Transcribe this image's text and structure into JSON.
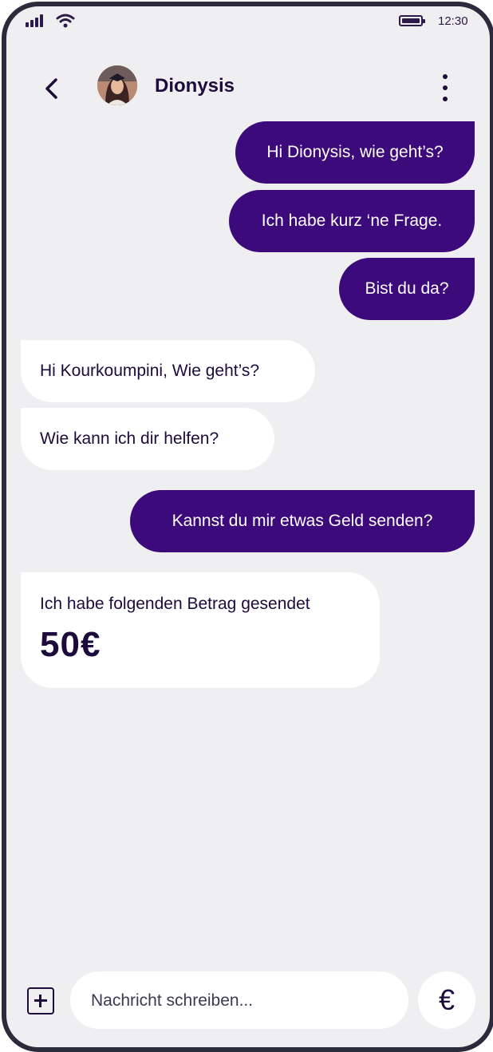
{
  "status_bar": {
    "time": "12:30",
    "icons": [
      "signal-icon",
      "wifi-icon",
      "battery-icon"
    ]
  },
  "header": {
    "back_icon": "chevron-left-icon",
    "contact_name": "Dionysis",
    "more_icon": "more-vertical-icon"
  },
  "messages": [
    {
      "direction": "outgoing",
      "text": "Hi Dionysis, wie geht’s?"
    },
    {
      "direction": "outgoing",
      "text": "Ich habe kurz ‘ne Frage."
    },
    {
      "direction": "outgoing",
      "text": "Bist du da?"
    },
    {
      "direction": "incoming",
      "text": "Hi Kourkoumpini, Wie geht’s?"
    },
    {
      "direction": "incoming",
      "text": "Wie kann ich dir helfen?"
    },
    {
      "direction": "outgoing",
      "text": "Kannst du mir etwas Geld senden?"
    },
    {
      "direction": "incoming",
      "text": "Ich habe folgenden Betrag gesendet",
      "amount": "50€"
    }
  ],
  "composer": {
    "add_icon": "plus-square-icon",
    "placeholder": "Nachricht schreiben...",
    "send_money_icon": "euro-icon",
    "send_money_label": "€"
  },
  "colors": {
    "outgoing_bubble": "#3c0a7a",
    "incoming_bubble": "#ffffff",
    "background": "#efeff1",
    "text_dark": "#1c0b3b"
  }
}
